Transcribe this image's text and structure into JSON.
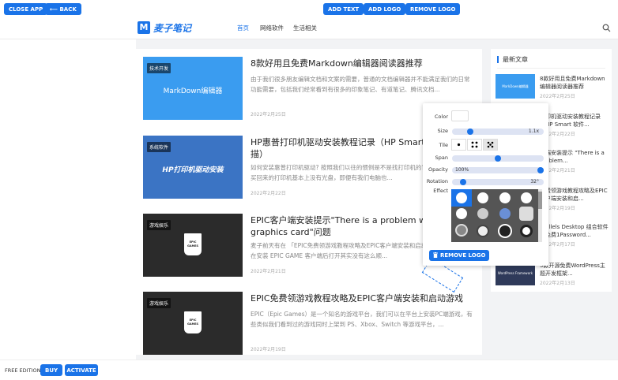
{
  "toolbar": {
    "close_app": "CLOSE APP",
    "back": "⟵ BACK",
    "add_text": "ADD TEXT",
    "add_logo": "ADD LOGO",
    "remove_logo": "REMOVE LOGO"
  },
  "site": {
    "logo_badge": "M",
    "logo_text": "麦子笔记",
    "nav": [
      "首页",
      "网络软件",
      "生活相关"
    ]
  },
  "articles": [
    {
      "tag": "技术开发",
      "thumb_text": "MarkDown编辑器",
      "title": "8款好用且免费Markdown编辑器阅读器推荐",
      "desc": "由于我们很多朋友编辑文档和文案的需要，普通的文档编辑器并不能满足我们的日常功能需要，包括我们经常看到有很多的印象笔记、有道笔记、腾讯文档...",
      "date": "2022年2月25日",
      "thumb_color": "#3a9cf0"
    },
    {
      "tag": "系统软件",
      "thumb_text": "HP打印机驱动安装",
      "title": "HP惠普打印机驱动安装教程记录（HP Smart 软件印扫描）",
      "desc": "如何安装惠普打印机驱动? 按照我们以往的惯例是不是找打印机的官方驱动，如今我们买回来的打印机基本上没有光盘，即便有我们电脑也...",
      "date": "2022年2月22日",
      "thumb_color": "#3b74c4"
    },
    {
      "tag": "游戏娱乐",
      "thumb_text": "EPIC GAMES",
      "title": "EPIC客户端安装提示\"There is a problem with your graphics card\"问题",
      "desc": "麦子前天有在 「EPIC免费领游戏教程攻略及EPIC客户端安装和启动游戏」中有记录到在安装 EPIC GAME 客户端后打开其实没有这么顺...",
      "date": "2022年2月21日",
      "thumb_color": "#2b2b2b"
    },
    {
      "tag": "游戏娱乐",
      "thumb_text": "EPIC GAMES",
      "title": "EPIC免费领游戏教程攻略及EPIC客户端安装和启动游戏",
      "desc": "EPIC（Epic Games）是一个知名的游戏平台，我们可以在平台上安装PC端游戏，有些类似我们看到过的游戏同时上架到 PS、Xbox、Switch 等游戏平台，...",
      "date": "2022年2月19日",
      "thumb_color": "#2b2b2b"
    }
  ],
  "sidebar": {
    "title": "最新文章",
    "items": [
      {
        "thumb_text": "MarkDown编辑器",
        "title": "8款好用且免费Markdown编辑器阅读器推荐",
        "date": "2022年2月25日",
        "color": "#3a9cf0"
      },
      {
        "thumb_text": "",
        "title": "打印机驱动安装教程记录（HP Smart 软件...",
        "date": "2022年2月22日",
        "color": "#3b74c4"
      },
      {
        "thumb_text": "",
        "title": "户端安装提示 \"There is a problem...",
        "date": "2022年2月21日",
        "color": "#2b2b2b"
      },
      {
        "thumb_text": "",
        "title": "免费领游戏教程攻略及EPIC客户端安装和启...",
        "date": "2022年2月19日",
        "color": "#2b2b2b"
      },
      {
        "thumb_text": "",
        "title": "arallels Desktop 组合软件－免费1Password...",
        "date": "2022年2月17日",
        "color": "#d94a3a"
      },
      {
        "thumb_text": "WordPress Framework",
        "title": "5款开源免费WordPress主题开发框架...",
        "date": "2022年2月13日",
        "color": "#2f3a5a"
      }
    ]
  },
  "popup": {
    "color_label": "Color",
    "size_label": "Size",
    "size_value": "1.1x",
    "size_level": 0.18,
    "tile_label": "Tile",
    "span_label": "Span",
    "span_level": 0.5,
    "opacity_label": "Opacity",
    "opacity_value": "100%",
    "opacity_level": 1.0,
    "rotation_label": "Rotation",
    "rotation_value": "32°",
    "rotation_level": 0.09,
    "effect_label": "Effect",
    "remove_logo": "REMOVE LOGO"
  },
  "bottom": {
    "edition": "FREE EDITION",
    "buy": "BUY",
    "activate": "ACTIVATE"
  },
  "colors": {
    "accent": "#1a73e8"
  }
}
